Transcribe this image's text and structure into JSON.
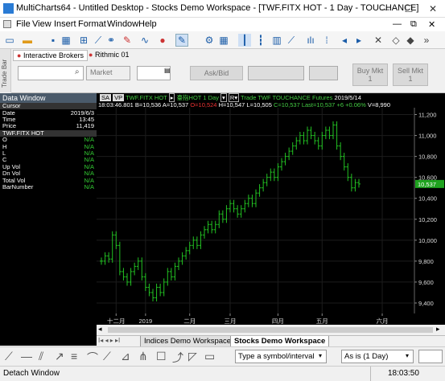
{
  "window": {
    "title": "MultiCharts64 - Untitled Desktop - Stocks Demo Workspace - [TWF.FITX HOT - 1 Day - TOUCHANCE]"
  },
  "menu": [
    "File",
    "View",
    "Insert",
    "Format",
    "Window",
    "Help"
  ],
  "tradebar": {
    "side_label": "Trade Bar",
    "tabs": [
      "Interactive Brokers",
      "Rithmic 01"
    ],
    "order_type": "Market",
    "ask_bid": "Ask/Bid",
    "buy_label": "Buy Mkt",
    "buy_qty": "1",
    "sell_label": "Sell Mkt",
    "sell_qty": "1"
  },
  "data_window": {
    "title": "Data Window",
    "cursor_label": "Cursor",
    "rows": [
      {
        "k": "Date",
        "v": "2019/6/3"
      },
      {
        "k": "Time",
        "v": "13:45"
      },
      {
        "k": "Price",
        "v": "11,419"
      }
    ],
    "symbol": "TWF.FITX HOT",
    "fields": [
      {
        "k": "O",
        "v": "N/A"
      },
      {
        "k": "H",
        "v": "N/A"
      },
      {
        "k": "L",
        "v": "N/A"
      },
      {
        "k": "C",
        "v": "N/A"
      },
      {
        "k": "Up Vol",
        "v": "N/A"
      },
      {
        "k": "Dn Vol",
        "v": "N/A"
      },
      {
        "k": "Total Vol",
        "v": "N/A"
      },
      {
        "k": "BarNumber",
        "v": "N/A"
      }
    ]
  },
  "chart": {
    "header1": {
      "sa": "SA",
      "vp": "VP",
      "symbol": "TWF.FITX HOT",
      "name": "臺指HOT",
      "interval": "1 Day",
      "mode": "Trade",
      "exchange": "TWF",
      "feed": "TOUCHANCE",
      "category": "Futures",
      "date": "2019/5/14"
    },
    "header2": {
      "time": "18:03:46.801",
      "b": "B=10,536",
      "a": "A=10,537",
      "o": "O=10,524",
      "h": "H=10,547",
      "l": "L=10,505",
      "c": "C=10,537",
      "last": "Last=10,537",
      "chg": "+6",
      "chgpct": "+0.06%",
      "v": "V=8,990"
    },
    "last_price_tag": "10,537"
  },
  "chart_data": {
    "type": "line",
    "title": "",
    "xlabel": "",
    "ylabel": "",
    "x_ticks": [
      "十二月",
      "2019",
      "二月",
      "三月",
      "四月",
      "五月",
      "六月"
    ],
    "y_ticks": [
      9400,
      9600,
      9800,
      10000,
      10200,
      10400,
      10600,
      10800,
      11000,
      11200
    ],
    "ylim": [
      9300,
      11250
    ],
    "series": [
      {
        "values": [
          9800,
          9850,
          9820,
          10050,
          9950,
          9700,
          9650,
          9600,
          9700,
          9750,
          9800,
          9650,
          9550,
          9500,
          9450,
          9550,
          9500,
          9600,
          9700,
          9650,
          9750,
          9800,
          9850,
          9900,
          9950,
          10000,
          9950,
          10050,
          10100,
          10150,
          10100,
          10150,
          10250,
          10200,
          10300,
          10350,
          10300,
          10250,
          10300,
          10350,
          10400,
          10350,
          10450,
          10500,
          10550,
          10600,
          10650,
          10600,
          10700,
          10750,
          10800,
          10850,
          10900,
          10950,
          11000,
          10950,
          11050,
          11000,
          10950,
          10900,
          11000,
          11050,
          11000,
          11100,
          10900,
          10800,
          10700,
          10600,
          10500,
          10550,
          10537
        ]
      }
    ]
  },
  "sheet_tabs": [
    "Indices Demo Workspace",
    "Stocks Demo Workspace"
  ],
  "drawbar": {
    "symbol_placeholder": "Type a symbol/interval",
    "resolution": "As is (1 Day)"
  },
  "status": {
    "left": "Detach Window",
    "time": "18:03:50"
  }
}
